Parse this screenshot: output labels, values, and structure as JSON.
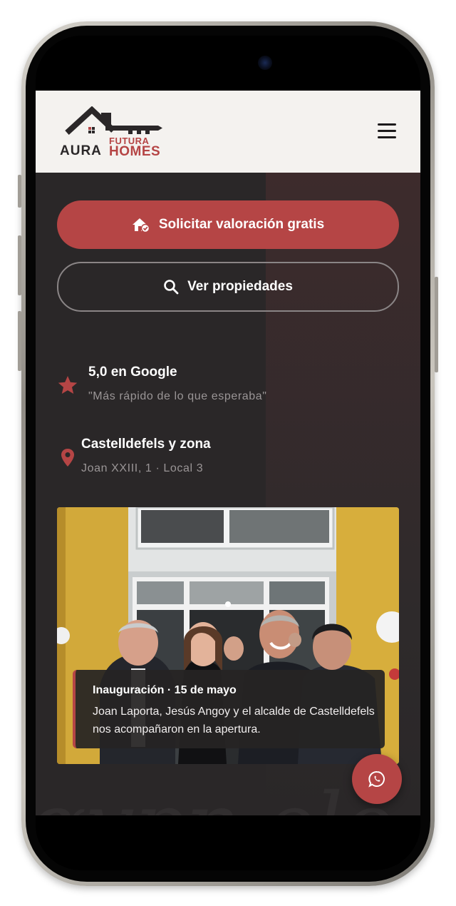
{
  "header": {
    "logo": {
      "word1": "AURA",
      "word2": "FUTURA",
      "word3": "HOMES"
    },
    "menu_icon": "hamburger-menu-icon"
  },
  "actions": {
    "primary_label": "Solicitar valoración gratis",
    "primary_icon": "house-check-icon",
    "secondary_label": "Ver propiedades",
    "secondary_icon": "search-icon"
  },
  "rating": {
    "title": "5,0 en Google",
    "quote": "\"Más rápido de lo que esperaba\"",
    "icon": "star-icon"
  },
  "location": {
    "title": "Castelldefels y zona",
    "address": "Joan XXIII, 1 · Local 3",
    "icon": "map-pin-icon"
  },
  "photo": {
    "caption_title": "Inauguración · 15 de mayo",
    "caption_text": "Joan Laporta, Jesús Angoy y el alcalde de Castelldefels nos acompañaron en la apertura."
  },
  "whatsapp": {
    "icon": "whatsapp-icon"
  },
  "colors": {
    "accent": "#b54545",
    "background": "#2a2728",
    "header": "#f4f2ef"
  }
}
